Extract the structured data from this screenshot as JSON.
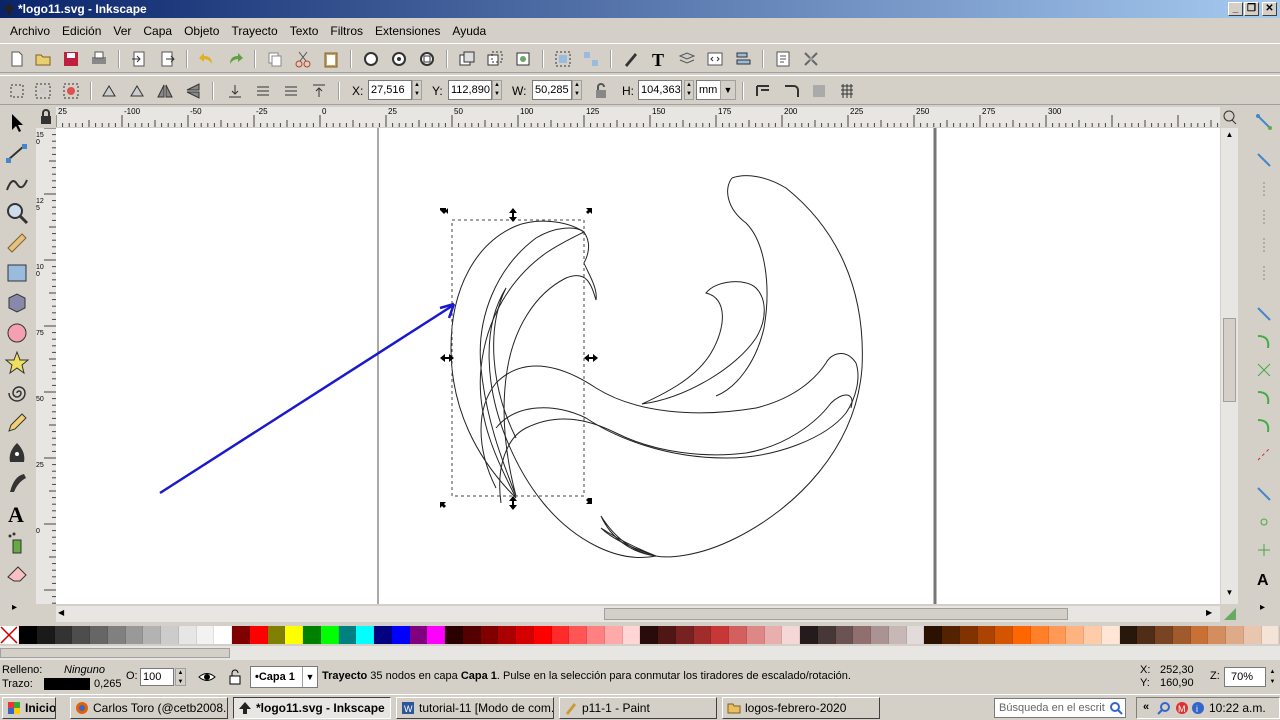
{
  "window": {
    "title": "*logo11.svg - Inkscape"
  },
  "menu": [
    "Archivo",
    "Edición",
    "Ver",
    "Capa",
    "Objeto",
    "Trayecto",
    "Texto",
    "Filtros",
    "Extensiones",
    "Ayuda"
  ],
  "coords": {
    "x_label": "X:",
    "x_value": "27,516",
    "y_label": "Y:",
    "y_value": "112,890",
    "w_label": "W:",
    "w_value": "50,285",
    "h_label": "H:",
    "h_value": "104,363",
    "unit": "mm"
  },
  "hruler_labels": [
    "25",
    "-100",
    "-50",
    "-25",
    "0",
    "25",
    "50",
    "100",
    "125",
    "150",
    "175",
    "200",
    "225",
    "250",
    "275",
    "300"
  ],
  "vruler_labels": [
    "150",
    "125",
    "100",
    "75",
    "50",
    "25",
    "0"
  ],
  "status": {
    "fill_label": "Relleno:",
    "fill_value": "Ninguno",
    "stroke_label": "Trazo:",
    "stroke_width": "0,265",
    "opacity_label": "O:",
    "opacity_value": "100",
    "layer": "•Capa 1",
    "message_bold": "Trayecto",
    "message_1": " 35 nodos en capa ",
    "message_layer": "Capa 1",
    "message_2": ". Pulse en la selección para conmutar los tiradores de escalado/rotación.",
    "cursor_x_label": "X:",
    "cursor_x": "252,30",
    "cursor_y_label": "Y:",
    "cursor_y": "160,90",
    "zoom_label": "Z:",
    "zoom": "70%"
  },
  "palette": [
    "#000000",
    "#1a1a1a",
    "#333333",
    "#4d4d4d",
    "#666666",
    "#808080",
    "#999999",
    "#b3b3b3",
    "#cccccc",
    "#e6e6e6",
    "#f2f2f2",
    "#ffffff",
    "#800000",
    "#ff0000",
    "#808000",
    "#ffff00",
    "#008000",
    "#00ff00",
    "#008080",
    "#00ffff",
    "#000080",
    "#0000ff",
    "#800080",
    "#ff00ff",
    "#2b0000",
    "#550000",
    "#800000",
    "#aa0000",
    "#d40000",
    "#ff0000",
    "#ff2a2a",
    "#ff5555",
    "#ff8080",
    "#ffaaaa",
    "#ffd5d5",
    "#280b0b",
    "#501616",
    "#782121",
    "#a02c2c",
    "#c83737",
    "#d35f5f",
    "#de8787",
    "#e9afaf",
    "#f4d7d7",
    "#241c1c",
    "#483737",
    "#6c5353",
    "#916f6f",
    "#ac9393",
    "#c8b7b7",
    "#e3dbdb",
    "#2b1100",
    "#552200",
    "#803300",
    "#aa4400",
    "#d45500",
    "#ff6600",
    "#ff7f2a",
    "#ff9955",
    "#ffb380",
    "#ffccaa",
    "#ffe6d5",
    "#28170b",
    "#502d16",
    "#784421",
    "#a05a2c",
    "#c87137",
    "#d38d5f",
    "#deaa87",
    "#e9c6af",
    "#f4e3d7"
  ],
  "taskbar": {
    "start": "Inicio",
    "tasks": [
      "Carlos Toro (@cetb2008...",
      "*logo11.svg - Inkscape",
      "tutorial-11 [Modo de com...",
      "p11-1 - Paint",
      "logos-febrero-2020"
    ],
    "search_placeholder": "Búsqueda en el escrit",
    "clock": "10:22 a.m."
  },
  "colors": {
    "accent_arrow": "#1a1acc",
    "title_gradient_start": "#0a246a"
  }
}
